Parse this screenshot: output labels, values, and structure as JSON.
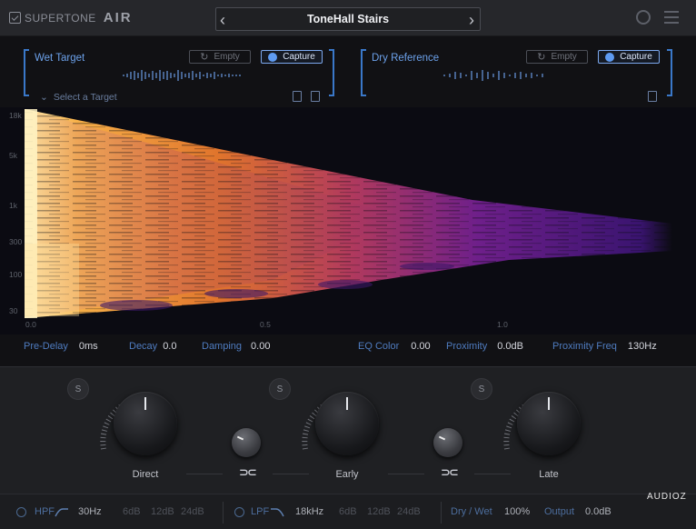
{
  "header": {
    "brand": "SUPERTONE",
    "product": "AIR",
    "preset_name": "ToneHall Stairs",
    "prev_icon": "chevron-left-icon",
    "next_icon": "chevron-right-icon"
  },
  "wet_target": {
    "label": "Wet Target",
    "empty_label": "Empty",
    "capture_label": "Capture",
    "select_label": "Select a Target"
  },
  "dry_reference": {
    "label": "Dry Reference",
    "empty_label": "Empty",
    "capture_label": "Capture"
  },
  "spectrogram": {
    "y_ticks": [
      "18k",
      "5k",
      "1k",
      "300",
      "100",
      "30"
    ],
    "x_ticks": [
      "0.0",
      "0.5",
      "1.0"
    ],
    "colors": {
      "hot": "#ffe9a6",
      "mid": "#f09a3a",
      "cool": "#7a1d8a",
      "bg": "#0b0b12"
    }
  },
  "params": {
    "pre_delay": {
      "label": "Pre-Delay",
      "value": "0ms"
    },
    "decay": {
      "label": "Decay",
      "value": "0.0"
    },
    "damping": {
      "label": "Damping",
      "value": "0.00"
    },
    "eq_color": {
      "label": "EQ Color",
      "value": "0.00"
    },
    "proximity": {
      "label": "Proximity",
      "value": "0.0dB"
    },
    "proximity_freq": {
      "label": "Proximity Freq",
      "value": "130Hz"
    }
  },
  "knobs": {
    "solo_label": "S",
    "direct": "Direct",
    "early": "Early",
    "late": "Late"
  },
  "bottom": {
    "hpf_label": "HPF",
    "hpf_value": "30Hz",
    "hpf_slopes": [
      "6dB",
      "12dB",
      "24dB"
    ],
    "lpf_label": "LPF",
    "lpf_value": "18kHz",
    "lpf_slopes": [
      "6dB",
      "12dB",
      "24dB"
    ],
    "drywet_label": "Dry / Wet",
    "drywet_value": "100%",
    "output_label": "Output",
    "output_value": "0.0dB"
  },
  "watermark": "AUDIOZ",
  "theme": {
    "accent": "#3a78c9",
    "label_blue": "#4f7cc0"
  }
}
